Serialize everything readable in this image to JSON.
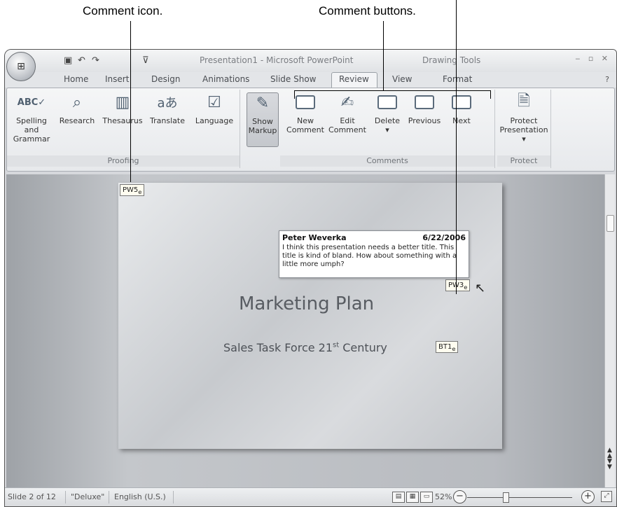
{
  "callouts": {
    "comment_icon": "Comment icon.",
    "comment_buttons": "Comment buttons."
  },
  "titlebar": {
    "document_title": "Presentation1 - Microsoft PowerPoint",
    "context_tab": "Drawing Tools",
    "office_button_icon": "office-logo-icon",
    "quick_access": [
      "save-icon",
      "undo-icon",
      "redo-icon",
      "customize-icon"
    ]
  },
  "tabs": [
    "Home",
    "Insert",
    "Design",
    "Animations",
    "Slide Show",
    "Review",
    "View",
    "Format"
  ],
  "active_tab": "Review",
  "ribbon": {
    "proofing": {
      "label": "Proofing",
      "buttons": [
        {
          "label": "Spelling and\nGrammar",
          "icon": "spelling-check-icon"
        },
        {
          "label": "Research",
          "icon": "research-icon"
        },
        {
          "label": "Thesaurus",
          "icon": "thesaurus-icon"
        },
        {
          "label": "Translate",
          "icon": "translate-icon"
        },
        {
          "label": "Language",
          "icon": "language-icon"
        }
      ]
    },
    "show_markup": {
      "label": "Show\nMarkup",
      "icon": "show-markup-icon",
      "state": "on"
    },
    "comments": {
      "label": "Comments",
      "buttons": [
        {
          "label": "New\nComment",
          "icon": "new-comment-icon"
        },
        {
          "label": "Edit\nComment",
          "icon": "edit-comment-icon"
        },
        {
          "label": "Delete\n▾",
          "icon": "delete-comment-icon"
        },
        {
          "label": "Previous",
          "icon": "previous-comment-icon"
        },
        {
          "label": "Next",
          "icon": "next-comment-icon"
        }
      ]
    },
    "protect": {
      "label": "Protect",
      "buttons": [
        {
          "label": "Protect\nPresentation ▾",
          "icon": "protect-presentation-icon"
        }
      ]
    }
  },
  "slide": {
    "title": "Marketing Plan",
    "subtitle_prefix": "Sales Task Force 21",
    "subtitle_sup": "st",
    "subtitle_suffix": " Century"
  },
  "markers": {
    "pw5": "PW5",
    "pw5_sub": "e",
    "pw3": "PW3",
    "pw3_sub": "e",
    "bt1": "BT1",
    "bt1_sub": "e"
  },
  "comment": {
    "author": "Peter Weverka",
    "date": "6/22/2006",
    "text": "I think this presentation needs a better title. This title is kind of bland. How about something with a little more umph?"
  },
  "statusbar": {
    "slide_info": "Slide 2 of 12",
    "theme": "\"Deluxe\"",
    "language": "English (U.S.)",
    "zoom": "52%"
  }
}
